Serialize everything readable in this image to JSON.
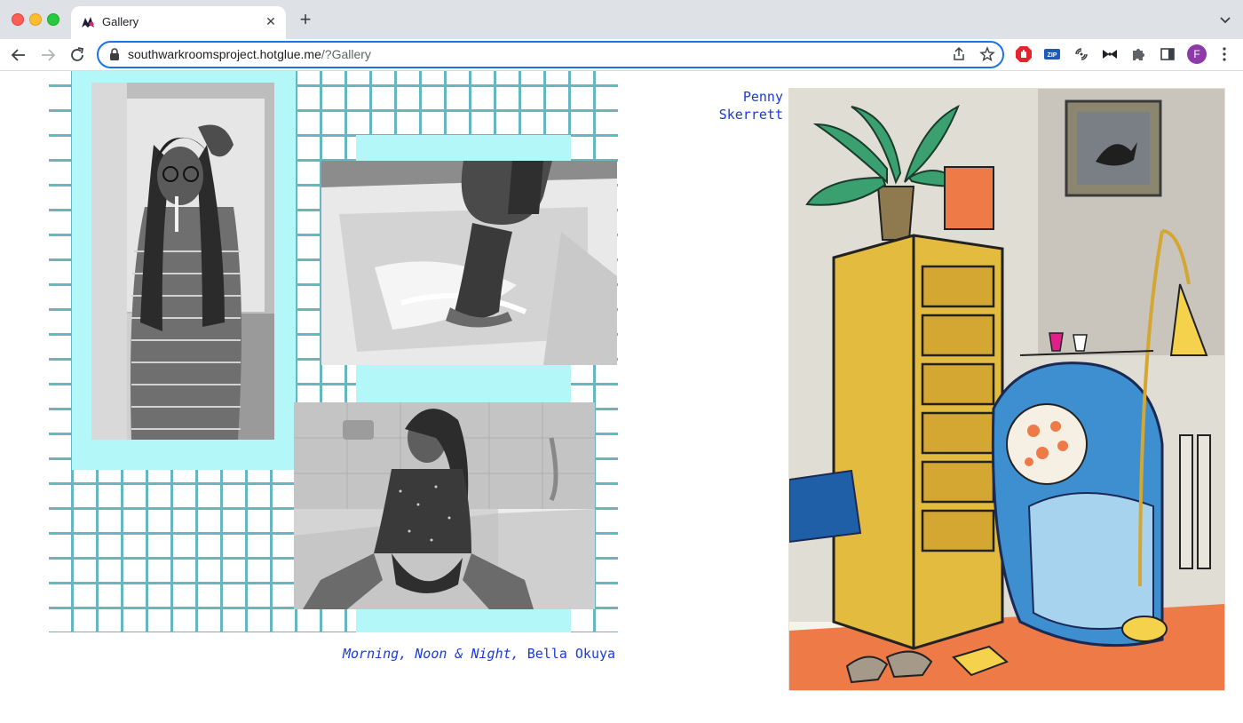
{
  "browser": {
    "tab": {
      "title": "Gallery",
      "close_glyph": "✕"
    },
    "new_tab_glyph": "+",
    "address": {
      "domain": "southwarkroomsproject.hotglue.me",
      "path": "/?Gallery"
    },
    "profile_initial": "F",
    "extensions": [
      "adblock-icon",
      "zip-icon",
      "audio-icon",
      "bowtie-icon",
      "puzzle-icon",
      "sidepanel-icon"
    ],
    "accent_color": "#1a73e8"
  },
  "gallery": {
    "work_1": {
      "title": "Morning, Noon & Night,",
      "artist": "Bella Okuya"
    },
    "work_2": {
      "artist": "Penny Skerrett"
    },
    "caption_color": "#1a3ad9",
    "grid_color": "#66b7bf",
    "panel_color": "#b3f7f9"
  }
}
